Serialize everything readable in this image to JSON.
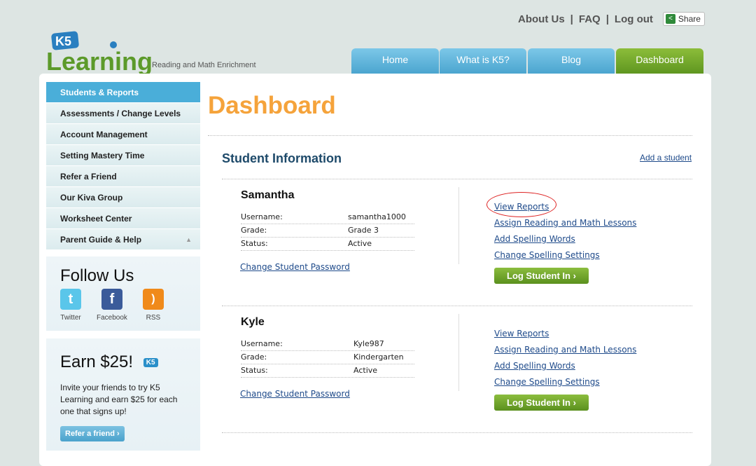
{
  "header": {
    "top_links": [
      "About Us",
      "FAQ",
      "Log out"
    ],
    "share_label": "Share",
    "logo_text": "K5 Learning",
    "tagline": "Reading and Math Enrichment",
    "tabs": [
      {
        "label": "Home"
      },
      {
        "label": "What is K5?"
      },
      {
        "label": "Blog"
      },
      {
        "label": "Dashboard",
        "active": true
      }
    ]
  },
  "sidebar": {
    "items": [
      {
        "label": "Students & Reports",
        "active": true
      },
      {
        "label": "Assessments / Change Levels"
      },
      {
        "label": "Account Management"
      },
      {
        "label": "Setting Mastery Time"
      },
      {
        "label": "Refer a Friend"
      },
      {
        "label": "Our Kiva Group"
      },
      {
        "label": "Worksheet Center"
      },
      {
        "label": "Parent Guide & Help"
      }
    ],
    "follow": {
      "title": "Follow Us",
      "items": [
        "Twitter",
        "Facebook",
        "RSS"
      ]
    },
    "earn": {
      "title": "Earn $25!",
      "text": "Invite your friends to try K5 Learning and earn $25 for each one that signs up!",
      "button": "Refer a friend"
    }
  },
  "main": {
    "title": "Dashboard",
    "section_title": "Student Information",
    "add_student": "Add a student",
    "labels": {
      "username": "Username:",
      "grade": "Grade:",
      "status": "Status:",
      "change_password": "Change Student Password",
      "view_reports": "View Reports",
      "assign": "Assign Reading and Math Lessons",
      "add_spelling": "Add Spelling Words",
      "change_spelling": "Change Spelling Settings",
      "login": "Log Student In"
    },
    "students": [
      {
        "name": "Samantha",
        "username": "samantha1000",
        "grade": "Grade 3",
        "status": "Active"
      },
      {
        "name": "Kyle",
        "username": "Kyle987",
        "grade": "Kindergarten",
        "status": "Active"
      }
    ]
  },
  "colors": {
    "accent_orange": "#f5a33b",
    "nav_blue": "#4aaed9",
    "green": "#6aa42a",
    "highlight_circle": "#dd2222"
  }
}
